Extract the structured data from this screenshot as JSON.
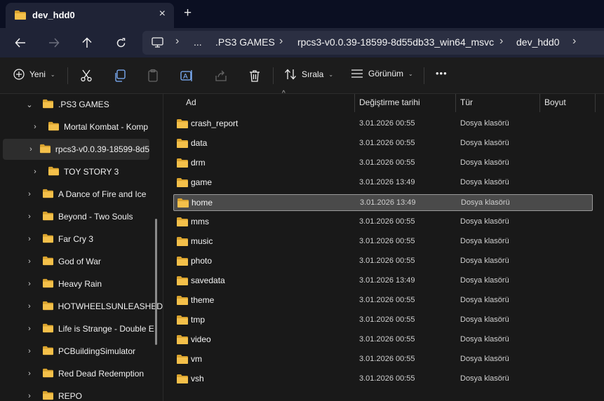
{
  "tab": {
    "title": "dev_hdd0",
    "close_icon": "×",
    "new_tab_icon": "+"
  },
  "breadcrumb": [
    "...",
    ".PS3 GAMES",
    "rpcs3-v0.0.39-18599-8d55db33_win64_msvc",
    "dev_hdd0"
  ],
  "commands": {
    "new_label": "Yeni",
    "sort_label": "Sırala",
    "view_label": "Görünüm",
    "more_label": "•••"
  },
  "sidebar": {
    "items": [
      {
        "label": ".PS3 GAMES",
        "arrow": "⌄",
        "indent": 1,
        "selected": false
      },
      {
        "label": "Mortal Kombat - Komp",
        "arrow": "›",
        "indent": 2,
        "selected": false
      },
      {
        "label": "rpcs3-v0.0.39-18599-8d5",
        "arrow": "›",
        "indent": 2,
        "selected": true
      },
      {
        "label": "TOY STORY 3",
        "arrow": "›",
        "indent": 2,
        "selected": false
      },
      {
        "label": "A Dance of Fire and Ice",
        "arrow": "›",
        "indent": 1,
        "selected": false
      },
      {
        "label": "Beyond - Two Souls",
        "arrow": "›",
        "indent": 1,
        "selected": false
      },
      {
        "label": "Far Cry 3",
        "arrow": "›",
        "indent": 1,
        "selected": false
      },
      {
        "label": "God of War",
        "arrow": "›",
        "indent": 1,
        "selected": false
      },
      {
        "label": "Heavy Rain",
        "arrow": "›",
        "indent": 1,
        "selected": false
      },
      {
        "label": "HOTWHEELSUNLEASHED",
        "arrow": "›",
        "indent": 1,
        "selected": false
      },
      {
        "label": "Life is Strange - Double E",
        "arrow": "›",
        "indent": 1,
        "selected": false
      },
      {
        "label": "PCBuildingSimulator",
        "arrow": "›",
        "indent": 1,
        "selected": false
      },
      {
        "label": "Red Dead Redemption",
        "arrow": "›",
        "indent": 1,
        "selected": false
      },
      {
        "label": "REPO",
        "arrow": "›",
        "indent": 1,
        "selected": false
      }
    ]
  },
  "columns": {
    "name": "Ad",
    "date": "Değiştirme tarihi",
    "type": "Tür",
    "size": "Boyut"
  },
  "files": [
    {
      "name": "crash_report",
      "date": "3.01.2026 00:55",
      "type": "Dosya klasörü",
      "selected": false
    },
    {
      "name": "data",
      "date": "3.01.2026 00:55",
      "type": "Dosya klasörü",
      "selected": false
    },
    {
      "name": "drm",
      "date": "3.01.2026 00:55",
      "type": "Dosya klasörü",
      "selected": false
    },
    {
      "name": "game",
      "date": "3.01.2026 13:49",
      "type": "Dosya klasörü",
      "selected": false
    },
    {
      "name": "home",
      "date": "3.01.2026 13:49",
      "type": "Dosya klasörü",
      "selected": true
    },
    {
      "name": "mms",
      "date": "3.01.2026 00:55",
      "type": "Dosya klasörü",
      "selected": false
    },
    {
      "name": "music",
      "date": "3.01.2026 00:55",
      "type": "Dosya klasörü",
      "selected": false
    },
    {
      "name": "photo",
      "date": "3.01.2026 00:55",
      "type": "Dosya klasörü",
      "selected": false
    },
    {
      "name": "savedata",
      "date": "3.01.2026 13:49",
      "type": "Dosya klasörü",
      "selected": false
    },
    {
      "name": "theme",
      "date": "3.01.2026 00:55",
      "type": "Dosya klasörü",
      "selected": false
    },
    {
      "name": "tmp",
      "date": "3.01.2026 00:55",
      "type": "Dosya klasörü",
      "selected": false
    },
    {
      "name": "video",
      "date": "3.01.2026 00:55",
      "type": "Dosya klasörü",
      "selected": false
    },
    {
      "name": "vm",
      "date": "3.01.2026 00:55",
      "type": "Dosya klasörü",
      "selected": false
    },
    {
      "name": "vsh",
      "date": "3.01.2026 00:55",
      "type": "Dosya klasörü",
      "selected": false
    }
  ],
  "colors": {
    "folder": "#f4c04a",
    "folder_dark": "#d9a32e",
    "accent": "#ffffff"
  }
}
